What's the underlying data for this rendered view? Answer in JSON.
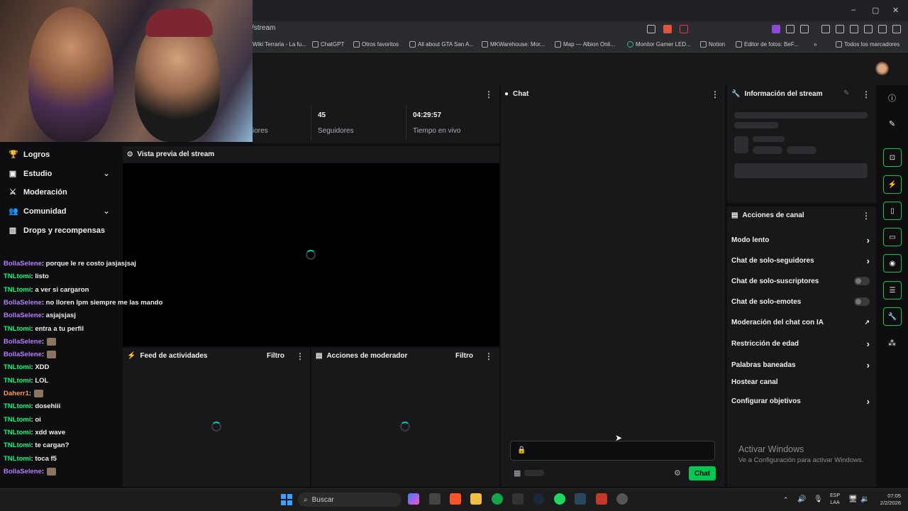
{
  "browser": {
    "url": "/stream",
    "bookmarks": [
      "Wiki Terraria - La fu...",
      "ChatGPT",
      "Otros favoritos",
      "All about GTA San A...",
      "MKWarehouse: Mor...",
      "Map — Albion Onli...",
      "Monitor Gamer LED...",
      "Notion",
      "Editor de fotos: BeF..."
    ],
    "bookmarks_more": "»",
    "all_bookmarks": "Todos los marcadores",
    "window_controls": [
      "–",
      "▢",
      "✕"
    ]
  },
  "stats": {
    "partial_label": "iores",
    "followers_value": "45",
    "followers_label": "Seguidores",
    "live_value": "04:29:57",
    "live_label": "Tiempo en vivo"
  },
  "nav": {
    "items": [
      {
        "label": "Logros",
        "icon": "trophy-icon"
      },
      {
        "label": "Estudio",
        "icon": "studio-icon"
      },
      {
        "label": "Moderación",
        "icon": "sword-icon"
      },
      {
        "label": "Comunidad",
        "icon": "people-icon"
      },
      {
        "label": "Drops y recompensas",
        "icon": "chart-icon"
      }
    ]
  },
  "preview": {
    "title": "Vista previa del stream"
  },
  "activity": {
    "title": "Feed de actividades",
    "filter": "Filtro"
  },
  "modactions": {
    "title": "Acciones de moderador",
    "filter": "Filtro"
  },
  "chat": {
    "title": "Chat",
    "send": "Chat",
    "lines": [
      {
        "user": "BollaSelene",
        "msg": ": porque le re costo jasjasjsaj",
        "color": "u2"
      },
      {
        "user": "TNLtomi",
        "msg": ": listo",
        "color": "u1"
      },
      {
        "user": "TNLtomi",
        "msg": ": a ver si cargaron",
        "color": "u1"
      },
      {
        "user": "BollaSelene",
        "msg": ": no lloren lpm siempre me las mando",
        "color": "u2"
      },
      {
        "user": "BollaSelene",
        "msg": ": asjajsjasj",
        "color": "u2"
      },
      {
        "user": "TNLtomi",
        "msg": ": entra a tu perfil",
        "color": "u1"
      },
      {
        "user": "BollaSelene",
        "msg": ":",
        "color": "u2",
        "emote": true
      },
      {
        "user": "BollaSelene",
        "msg": ":",
        "color": "u2",
        "emote": true
      },
      {
        "user": "TNLtomi",
        "msg": ": XDD",
        "color": "u1"
      },
      {
        "user": "TNLtomi",
        "msg": ": LOL",
        "color": "u1"
      },
      {
        "user": "Daherr1",
        "msg": ":",
        "color": "u3",
        "emote": true
      },
      {
        "user": "TNLtomi",
        "msg": ": dosehiii",
        "color": "u1"
      },
      {
        "user": "TNLtomi",
        "msg": ": oi",
        "color": "u1"
      },
      {
        "user": "TNLtomi",
        "msg": ": xdd wave",
        "color": "u1"
      },
      {
        "user": "TNLtomi",
        "msg": ": te cargan?",
        "color": "u1"
      },
      {
        "user": "TNLtomi",
        "msg": ": toca f5",
        "color": "u1"
      },
      {
        "user": "BollaSelene",
        "msg": ":",
        "color": "u2",
        "emote": true
      }
    ]
  },
  "info": {
    "title": "Información del stream"
  },
  "channel": {
    "title": "Acciones de canal",
    "items": [
      {
        "label": "Modo lento",
        "control": "arrow"
      },
      {
        "label": "Chat de solo-seguidores",
        "control": "arrow"
      },
      {
        "label": "Chat de solo-suscriptores",
        "control": "toggle"
      },
      {
        "label": "Chat de solo-emotes",
        "control": "toggle"
      },
      {
        "label": "Moderación del chat con IA",
        "control": "external"
      },
      {
        "label": "Restricción de edad",
        "control": "arrow"
      },
      {
        "label": "Palabras baneadas",
        "control": "arrow"
      },
      {
        "label": "Hostear canal",
        "control": "none"
      },
      {
        "label": "Configurar objetivos",
        "control": "arrow"
      }
    ]
  },
  "activate_windows": {
    "title": "Activar Windows",
    "subtitle": "Ve a Configuración para activar Windows."
  },
  "taskbar": {
    "search": "Buscar",
    "lang1": "ESP",
    "lang2": "LAA",
    "time": "07:05",
    "date": "2/2/2026"
  },
  "colors": {
    "accent": "#00c853",
    "teal": "#00c8af"
  }
}
